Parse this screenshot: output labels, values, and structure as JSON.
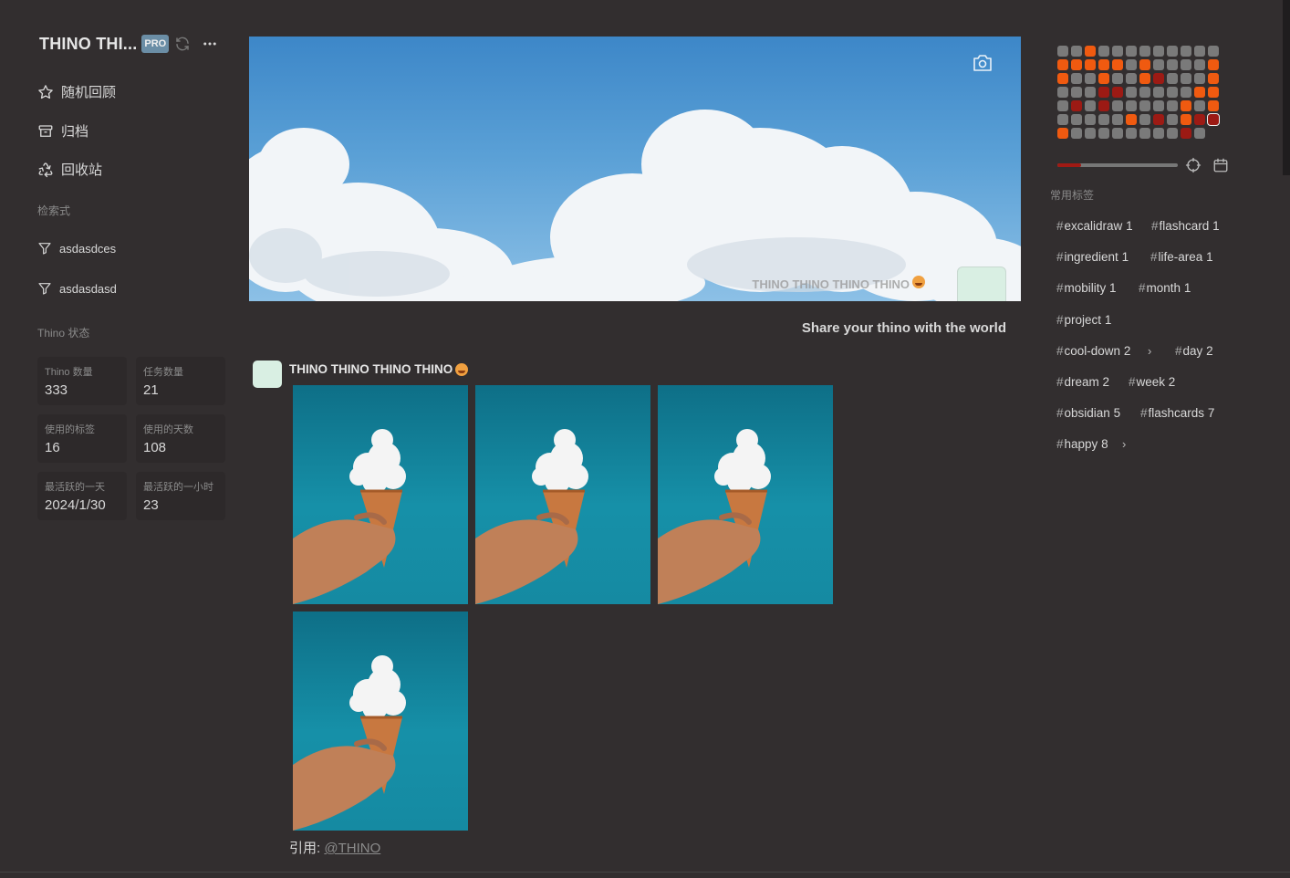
{
  "app": {
    "title": "THINO THI...",
    "badge": "PRO"
  },
  "nav": [
    {
      "label": "随机回顾",
      "icon": "star-icon"
    },
    {
      "label": "归档",
      "icon": "archive-icon"
    },
    {
      "label": "回收站",
      "icon": "recycle-icon"
    }
  ],
  "queries": {
    "title": "检索式",
    "items": [
      "asdasdces",
      "asdasdasd"
    ]
  },
  "stats": {
    "title": "Thino 状态",
    "cards": [
      {
        "label": "Thino 数量",
        "value": "333"
      },
      {
        "label": "任务数量",
        "value": "21"
      },
      {
        "label": "使用的标签",
        "value": "16"
      },
      {
        "label": "使用的天数",
        "value": "108"
      },
      {
        "label": "最活跃的一天",
        "value": "2024/1/30"
      },
      {
        "label": "最活跃的一小时",
        "value": "23"
      }
    ]
  },
  "banner": {
    "username": "THINO THINO THINO THINO",
    "share_text": "Share your thino with the world"
  },
  "memo": {
    "username": "THINO THINO THINO THINO",
    "quote_label": "引用:",
    "quote_link": "@THINO",
    "image_count": 4
  },
  "heatmap": {
    "rows": [
      "ggoggggggggg",
      "ooooogoggggo",
      "oggoggorgggo",
      "gggrrgggggoo",
      "grgrgggggogo",
      "gggggogrgorR",
      "oggggggggrg"
    ],
    "colors": {
      "g": "#7a7a7a",
      "o": "#f05a10",
      "r": "#9c1a14",
      "R": "#9c1a14"
    }
  },
  "slider": {
    "fraction": 0.2
  },
  "tags": {
    "title": "常用标签",
    "items": [
      {
        "name": "excalidraw",
        "count": "1"
      },
      {
        "name": "flashcard",
        "count": "1"
      },
      {
        "name": "ingredient",
        "count": "1"
      },
      {
        "name": "life-area",
        "count": "1"
      },
      {
        "name": "mobility",
        "count": "1"
      },
      {
        "name": "month",
        "count": "1"
      },
      {
        "name": "project",
        "count": "1"
      },
      {
        "name": "cool-down",
        "count": "2"
      },
      {
        "name": "day",
        "count": "2"
      },
      {
        "name": "dream",
        "count": "2"
      },
      {
        "name": "week",
        "count": "2"
      },
      {
        "name": "obsidian",
        "count": "5"
      },
      {
        "name": "flashcards",
        "count": "7"
      },
      {
        "name": "happy",
        "count": "8"
      }
    ]
  }
}
